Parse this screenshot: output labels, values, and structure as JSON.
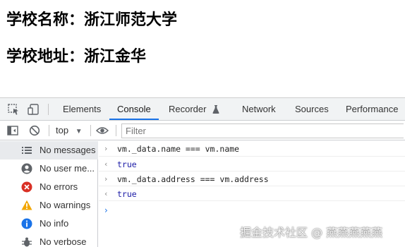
{
  "page": {
    "school_name_line": "学校名称：浙江师范大学",
    "school_address_line": "学校地址：浙江金华"
  },
  "devtools": {
    "tabs": [
      {
        "label": "Elements"
      },
      {
        "label": "Console",
        "active": true
      },
      {
        "label": "Recorder"
      },
      {
        "label": "Network"
      },
      {
        "label": "Sources"
      },
      {
        "label": "Performance"
      }
    ],
    "toolbar": {
      "context": "top",
      "filter_placeholder": "Filter"
    },
    "sidebar": {
      "items": [
        {
          "label": "No messages",
          "icon": "list-icon",
          "selected": true
        },
        {
          "label": "No user me...",
          "icon": "user-icon"
        },
        {
          "label": "No errors",
          "icon": "error-icon",
          "color": "#d93025"
        },
        {
          "label": "No warnings",
          "icon": "warning-icon",
          "color": "#f2a600"
        },
        {
          "label": "No info",
          "icon": "info-icon",
          "color": "#1a73e8"
        },
        {
          "label": "No verbose",
          "icon": "bug-icon"
        }
      ]
    },
    "console": {
      "entries": [
        {
          "type": "input",
          "text": "vm._data.name === vm.name"
        },
        {
          "type": "output",
          "text": "true"
        },
        {
          "type": "input",
          "text": "vm._data.address === vm.address"
        },
        {
          "type": "output",
          "text": "true"
        }
      ]
    }
  },
  "watermark": "掘金技术社区 @ 燕燕燕燕燕",
  "colors": {
    "accent": "#1a73e8",
    "output_value": "#1a1aa6",
    "error": "#d93025",
    "warning": "#f2a600"
  }
}
